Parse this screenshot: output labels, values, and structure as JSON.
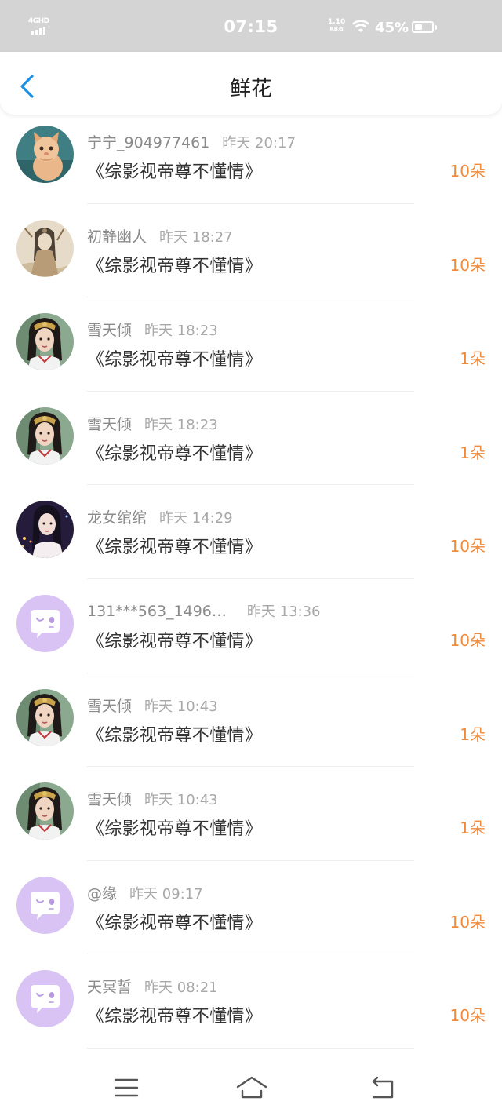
{
  "status_bar": {
    "network": "4GHD",
    "time": "07:15",
    "speed_value": "1.10",
    "speed_unit": "KB/s",
    "battery_percent": "45%",
    "battery_level": 0.45
  },
  "header": {
    "title": "鲜花",
    "back_icon": "chevron-left-icon",
    "accent_color": "#1a8fe8"
  },
  "count_color": "#f08a3c",
  "items": [
    {
      "name": "宁宁_904977461",
      "time": "昨天 20:17",
      "book": "《综影视帝尊不懂情》",
      "count": "10朵",
      "avatar": "kitten-photo"
    },
    {
      "name": "初静幽人",
      "time": "昨天 18:27",
      "book": "《综影视帝尊不懂情》",
      "count": "10朵",
      "avatar": "sepia-costume-photo"
    },
    {
      "name": "雪天倾",
      "time": "昨天 18:23",
      "book": "《综影视帝尊不懂情》",
      "count": "1朵",
      "avatar": "costume-actress-photo"
    },
    {
      "name": "雪天倾",
      "time": "昨天 18:23",
      "book": "《综影视帝尊不懂情》",
      "count": "1朵",
      "avatar": "costume-actress-photo"
    },
    {
      "name": "龙女绾绾",
      "time": "昨天 14:29",
      "book": "《综影视帝尊不懂情》",
      "count": "10朵",
      "avatar": "night-portrait-photo"
    },
    {
      "name": "131***563_1496…",
      "time": "昨天 13:36",
      "book": "《综影视帝尊不懂情》",
      "count": "10朵",
      "avatar": "default-chat-bubble-avatar"
    },
    {
      "name": "雪天倾",
      "time": "昨天 10:43",
      "book": "《综影视帝尊不懂情》",
      "count": "1朵",
      "avatar": "costume-actress-photo"
    },
    {
      "name": "雪天倾",
      "time": "昨天 10:43",
      "book": "《综影视帝尊不懂情》",
      "count": "1朵",
      "avatar": "costume-actress-photo"
    },
    {
      "name": "@缘",
      "time": "昨天 09:17",
      "book": "《综影视帝尊不懂情》",
      "count": "10朵",
      "avatar": "default-chat-bubble-avatar"
    },
    {
      "name": "天冥誓",
      "time": "昨天 08:21",
      "book": "《综影视帝尊不懂情》",
      "count": "10朵",
      "avatar": "default-chat-bubble-avatar"
    }
  ],
  "nav": {
    "menu_icon": "menu-icon",
    "home_icon": "home-icon",
    "back_icon": "back-arrow-icon"
  }
}
